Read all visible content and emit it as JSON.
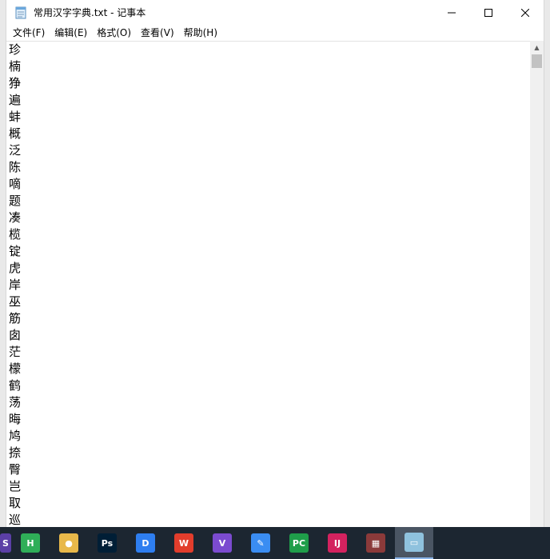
{
  "window": {
    "title": "常用汉字字典.txt - 记事本",
    "minimize_glyph": "—",
    "maximize_glyph": "☐",
    "close_glyph": "✕"
  },
  "menu": [
    "文件(F)",
    "编辑(E)",
    "格式(O)",
    "查看(V)",
    "帮助(H)"
  ],
  "lines": [
    "珍",
    "楠",
    "狰",
    "遍",
    "蚌",
    "概",
    "泛",
    "陈",
    "嘀",
    "题",
    "凑",
    "榄",
    "锭",
    "虎",
    "岸",
    "巫",
    "筋",
    "囱",
    "茫",
    "檬",
    "鹤",
    "荡",
    "晦",
    "鸠",
    "捺",
    "臀",
    "岂",
    "取",
    "巡"
  ],
  "taskbar": {
    "items": [
      {
        "name": "app-s-icon",
        "glyph": "S",
        "color": "#5b3fa6"
      },
      {
        "name": "hbuilder-icon",
        "glyph": "H",
        "color": "#2fae58"
      },
      {
        "name": "yellow-app-icon",
        "glyph": "●",
        "color": "#e8b84a"
      },
      {
        "name": "photoshop-icon",
        "glyph": "Ps",
        "color": "#001e36"
      },
      {
        "name": "dingtalk-icon",
        "glyph": "D",
        "color": "#2e7ef0"
      },
      {
        "name": "wps-icon",
        "glyph": "W",
        "color": "#e23d2c"
      },
      {
        "name": "visual-studio-icon",
        "glyph": "V",
        "color": "#7b4bd0"
      },
      {
        "name": "feishu-icon",
        "glyph": "✎",
        "color": "#3a8df2"
      },
      {
        "name": "pycharm-icon",
        "glyph": "PC",
        "color": "#1f9e4a"
      },
      {
        "name": "intellij-icon",
        "glyph": "IJ",
        "color": "#d3225f"
      },
      {
        "name": "winrar-icon",
        "glyph": "▦",
        "color": "#8b3a3a"
      },
      {
        "name": "notepad-icon",
        "glyph": "▭",
        "color": "#8fc2de"
      }
    ]
  }
}
